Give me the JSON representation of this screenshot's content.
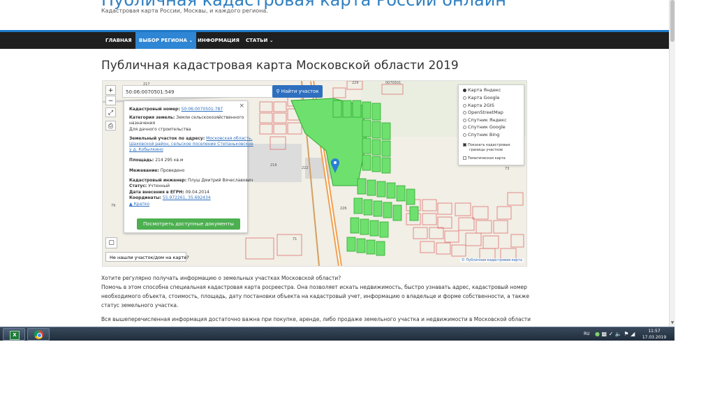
{
  "site": {
    "title": "Публичная кадастровая карта России онлайн",
    "subtitle": "Кадастровая карта России, Москвы, и каждого региона."
  },
  "nav": [
    {
      "label": "ГЛАВНАЯ"
    },
    {
      "label": "ВЫБОР РЕГИОНА ⌄",
      "active": true
    },
    {
      "label": "ИНФОРМАЦИЯ"
    },
    {
      "label": "СТАТЬИ ⌄"
    }
  ],
  "page_title": "Публичная кадастровая карта Московской области 2019",
  "map": {
    "search_value": "50:06:0070501:549",
    "search_button": "Найти участок",
    "tools": [
      "+",
      "−",
      "⤢",
      "⎙"
    ],
    "not_found": "Не нашли участок/дом на карте?",
    "attribution": "© Публичная кадастровая карта",
    "parcel_labels": [
      "217",
      "229",
      "0070501",
      "216",
      "222",
      "226",
      "79",
      "71",
      "73"
    ],
    "popup": {
      "cad_label": "Кадастровый номер:",
      "cad_value": "50:06:0070501:787",
      "category_label": "Категория земель:",
      "category_value_1": "Земли сельскохозяйственного",
      "category_value_2": "назначения",
      "usage": "Для дачного строительства",
      "address_label": "Земельный участок по адресу:",
      "address_1": "Московская область,",
      "address_2": "Шаховской район, сельское поселение Степаньковское",
      "address_3": "у д. Кобылкино",
      "area_label": "Площадь:",
      "area_value": "214 295 кв.м",
      "survey_label": "Межевание:",
      "survey_value": "Проведено",
      "engineer_label": "Кадастровый инженер:",
      "engineer_value": "Плуш Дмитрий Вячеславович",
      "status_label": "Статус:",
      "status_value": "Учтенный",
      "date_label": "Дата внесения в ЕГРН:",
      "date_value": "09.04.2014",
      "coords_label": "Координаты:",
      "coords_value": "55.972261, 35.692434",
      "brief": "▲ Кратко",
      "docs_button": "Посмотреть доступные документы"
    },
    "layers": {
      "options": [
        {
          "label": "Карта Яндекс",
          "selected": true
        },
        {
          "label": "Карта Google",
          "selected": false
        },
        {
          "label": "Карта 2GIS",
          "selected": false
        },
        {
          "label": "OpenStreetMap",
          "selected": false
        },
        {
          "label": "Спутник Яндекс",
          "selected": false
        },
        {
          "label": "Спутник Google",
          "selected": false
        },
        {
          "label": "Спутник Bing",
          "selected": false
        }
      ],
      "show_borders_1": "Показать кадастровые",
      "show_borders_2": "границы участков",
      "show_borders_checked": true,
      "thematic": "Тематическая карта",
      "thematic_checked": false
    }
  },
  "content": {
    "p1_line1": "Хотите регулярно получать информацию о земельных участках Московской области?",
    "p1_line2": "Помочь в этом способна специальная кадастровая карта росреестра. Она позволяет искать недвижимость, быстро узнавать адрес, кадастровый номер",
    "p1_line3": "необходимого объекта, стоимость, площадь, дату постановки объекта на кадастровый учет, информацию о владельце и форме собственности, а также",
    "p1_line4": "статус земельного участка.",
    "p2_line1": "Вся вышеперечисленная информация достаточно важна при покупке, аренде, либо продаже земельного участка и недвижимости в Московской области"
  },
  "taskbar": {
    "lang": "RU",
    "time": "11:57",
    "date": "17.03.2019"
  },
  "colors": {
    "accent": "#2e86d4",
    "nav_bg": "#1f1f1f",
    "parcel_green": "#6ee06e",
    "button_green": "#4caf50"
  }
}
